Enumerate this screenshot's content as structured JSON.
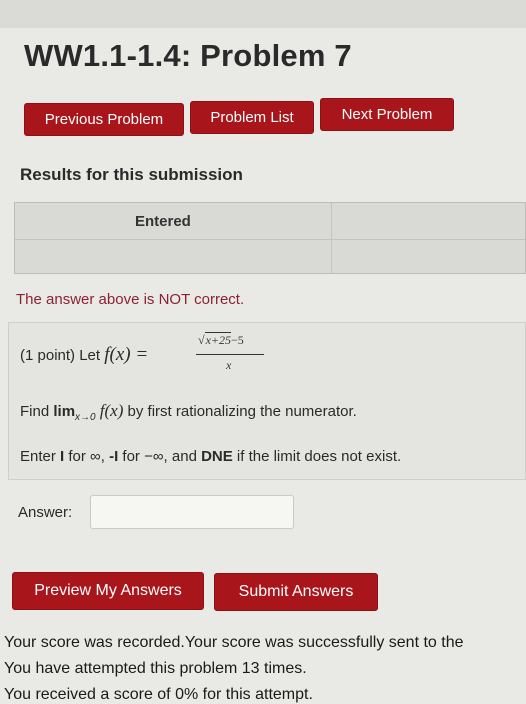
{
  "page": {
    "title": "WW1.1-1.4: Problem 7"
  },
  "nav": {
    "previous": "Previous Problem",
    "list": "Problem List",
    "next": "Next Problem"
  },
  "results": {
    "heading": "Results for this submission",
    "column_entered": "Entered",
    "feedback": "The answer above is NOT correct."
  },
  "problem": {
    "intro": "(1 point) Let ",
    "fx": "f(x) =",
    "numerator_radicand": "x+25",
    "numerator_rest": "−5",
    "denominator": "x",
    "instruction_find": "Find ",
    "limit_expr": "lim",
    "limit_sub": "x→0",
    "limit_fx": "f(x)",
    "instruction_rest": " by first rationalizing the numerator.",
    "enter_a": "Enter ",
    "enter_I": "I",
    "enter_b": " for ∞, ",
    "enter_negI": "-I",
    "enter_c": " for −∞, and ",
    "enter_DNE": "DNE",
    "enter_d": " if the limit does not exist."
  },
  "answer": {
    "label": "Answer:",
    "value": ""
  },
  "actions": {
    "preview": "Preview My Answers",
    "submit": "Submit Answers"
  },
  "messages": {
    "recorded": "Your score was recorded.Your score was successfully sent to the",
    "attempts": "You have attempted this problem 13 times.",
    "score": "You received a score of 0% for this attempt."
  },
  "colors": {
    "button": "#a8161b",
    "feedback": "#8b2230",
    "background": "#e9e9e6"
  }
}
